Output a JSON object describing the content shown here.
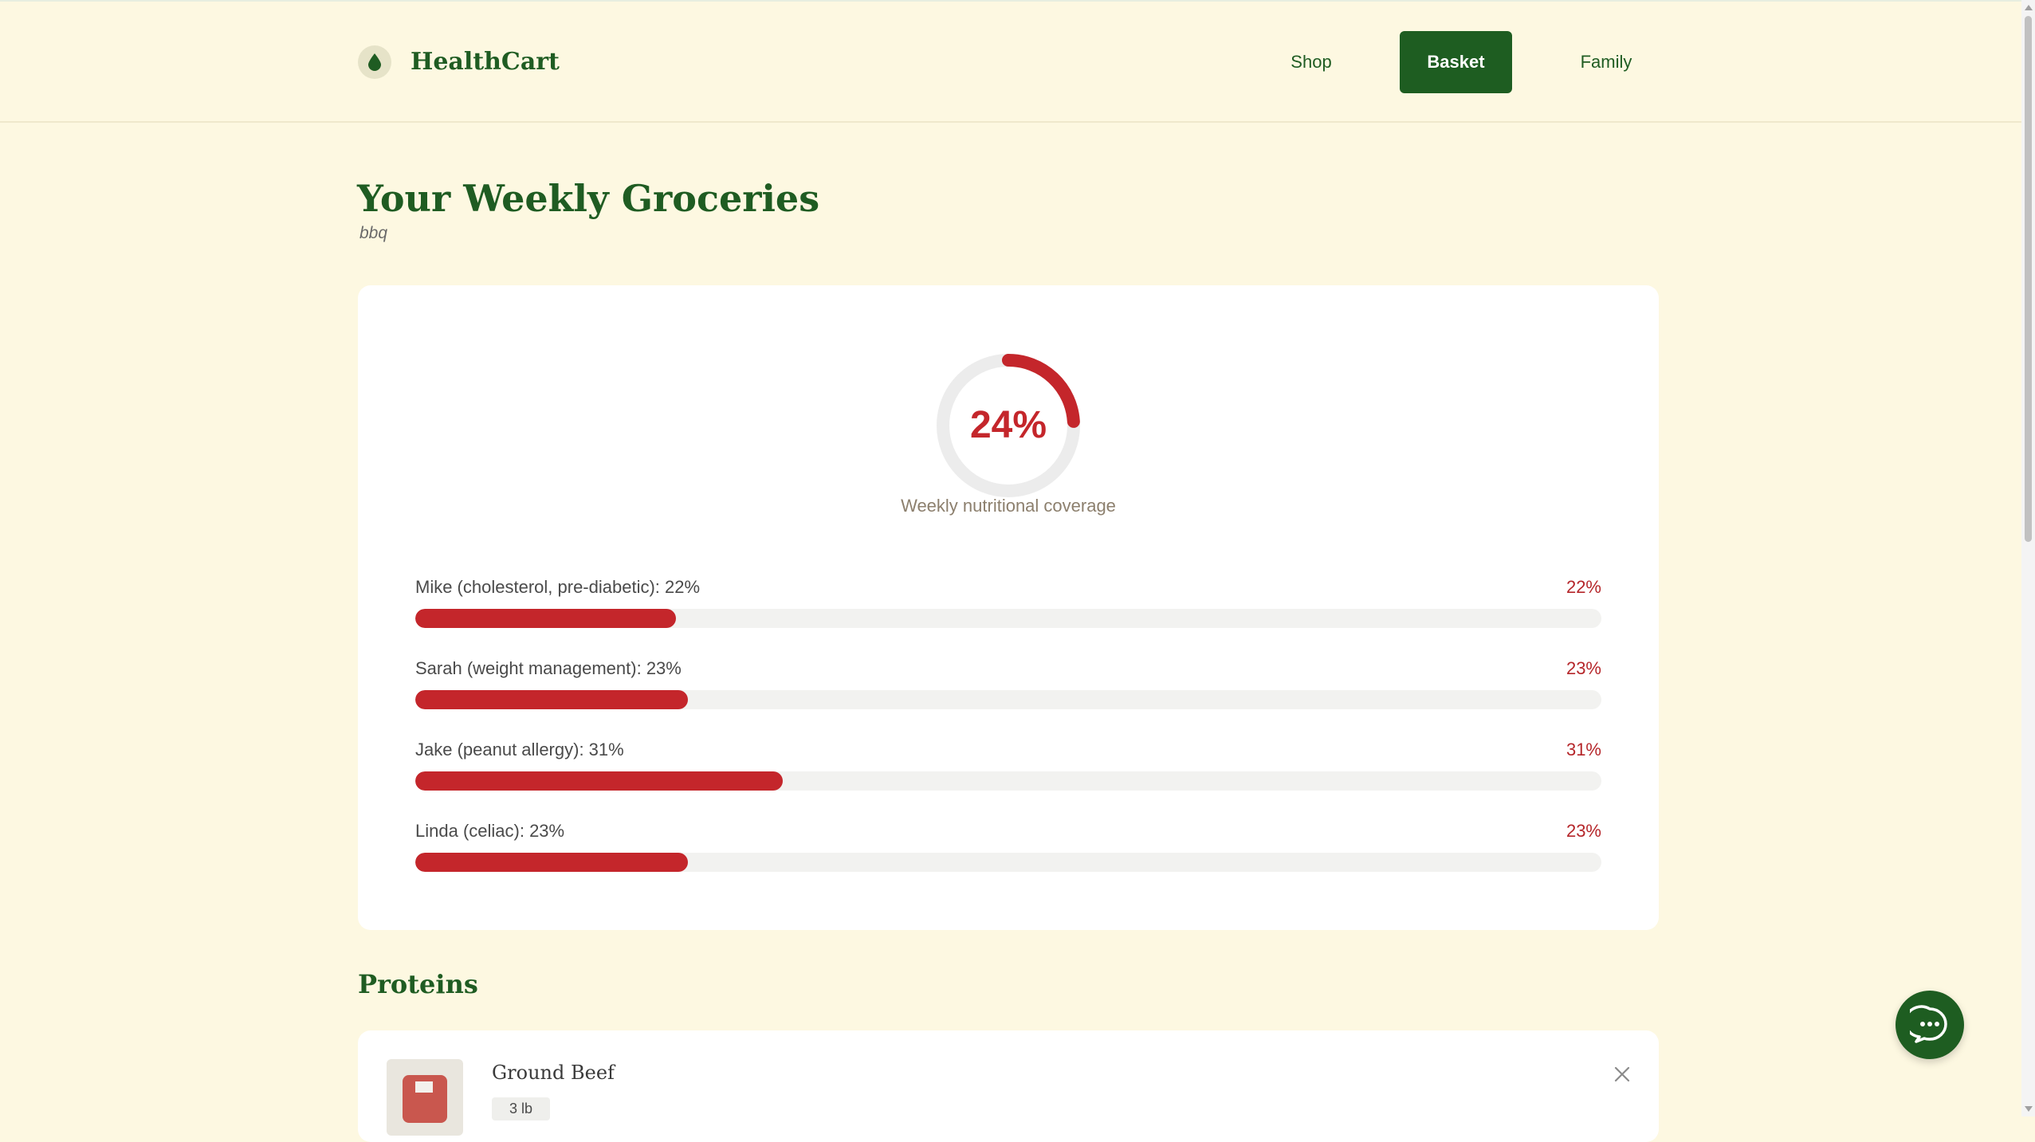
{
  "app": {
    "brand": "HealthCart",
    "accent_color": "#1e5d21",
    "alert_color": "#c4262b"
  },
  "nav": {
    "items": [
      {
        "label": "Shop",
        "active": false
      },
      {
        "label": "Basket",
        "active": true
      },
      {
        "label": "Family",
        "active": false
      }
    ]
  },
  "page": {
    "title": "Your Weekly Groceries",
    "subtitle": "bbq"
  },
  "coverage": {
    "value": 24,
    "label": "24%",
    "caption": "Weekly nutritional coverage",
    "members": [
      {
        "label": "Mike (cholesterol, pre-diabetic): 22%",
        "pct_label": "22%",
        "value": 22
      },
      {
        "label": "Sarah (weight management): 23%",
        "pct_label": "23%",
        "value": 23
      },
      {
        "label": "Jake (peanut allergy): 31%",
        "pct_label": "31%",
        "value": 31
      },
      {
        "label": "Linda (celiac): 23%",
        "pct_label": "23%",
        "value": 23
      }
    ]
  },
  "sections": [
    {
      "title": "Proteins",
      "items": [
        {
          "name": "Ground Beef",
          "qty": "3 lb",
          "icon": "ground-beef-image"
        }
      ]
    }
  ],
  "icons": {
    "logo": "leaf-drop-icon",
    "remove": "close-icon",
    "chat": "chat-bubble-icon"
  }
}
